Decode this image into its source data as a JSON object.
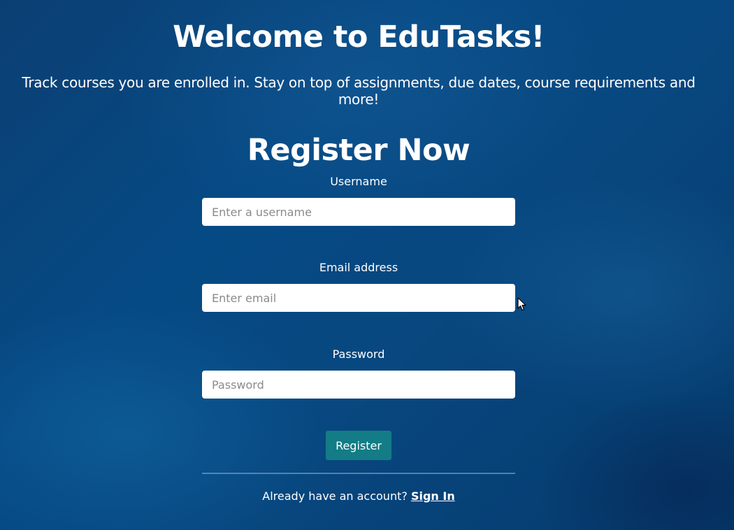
{
  "header": {
    "title": "Welcome to EduTasks!",
    "tagline": "Track courses you are enrolled in. Stay on top of assignments, due dates, course requirements and more!"
  },
  "form": {
    "title": "Register Now",
    "username": {
      "label": "Username",
      "placeholder": "Enter a username",
      "value": ""
    },
    "email": {
      "label": "Email address",
      "placeholder": "Enter email",
      "value": ""
    },
    "password": {
      "label": "Password",
      "placeholder": "Password",
      "value": ""
    },
    "submit_label": "Register"
  },
  "footer": {
    "prompt": "Already have an account?",
    "link_label": "Sign In"
  },
  "colors": {
    "background": "#064a85",
    "button": "#137c86",
    "text": "#ffffff"
  }
}
